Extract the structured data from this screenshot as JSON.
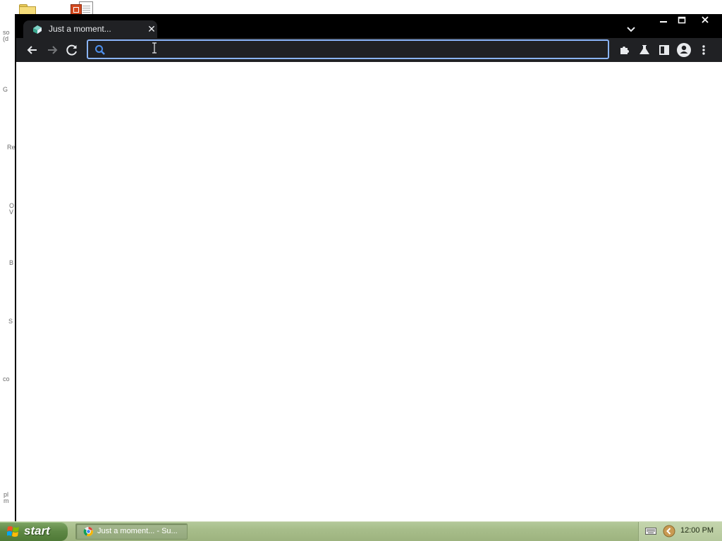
{
  "desktop": {
    "icons": [
      {
        "name": "folder-icon"
      },
      {
        "name": "powerpoint-document-icon"
      }
    ],
    "side_labels": [
      "so\n(d",
      "G",
      "Re",
      "O\nV",
      "B",
      "S",
      "co",
      "pl\nm"
    ]
  },
  "browser": {
    "tab": {
      "title": "Just a moment...",
      "favicon": "loading-favicon-icon",
      "close_label": "✕"
    },
    "tab_search_icon": "chevron-down-icon",
    "window_controls": [
      "minimize-icon",
      "maximize-icon",
      "close-icon"
    ],
    "toolbar": {
      "back_icon": "back-arrow-icon",
      "forward_icon": "forward-arrow-icon",
      "reload_icon": "reload-icon",
      "extensions_icon": "puzzle-icon",
      "labs_icon": "flask-icon",
      "side_panel_icon": "side-panel-icon",
      "profile_icon": "profile-icon",
      "menu_icon": "kebab-menu-icon"
    },
    "omnibox": {
      "value": "",
      "placeholder": "",
      "focus_color": "#8ab4f8"
    },
    "colors": {
      "frame": "#000000",
      "toolbar": "#202124",
      "text": "#e8eaed",
      "page": "#ffffff"
    }
  },
  "taskbar": {
    "start_label": "start",
    "task_items": [
      {
        "label": "Just a moment... - Su..."
      }
    ],
    "clock": "12:00 PM"
  }
}
